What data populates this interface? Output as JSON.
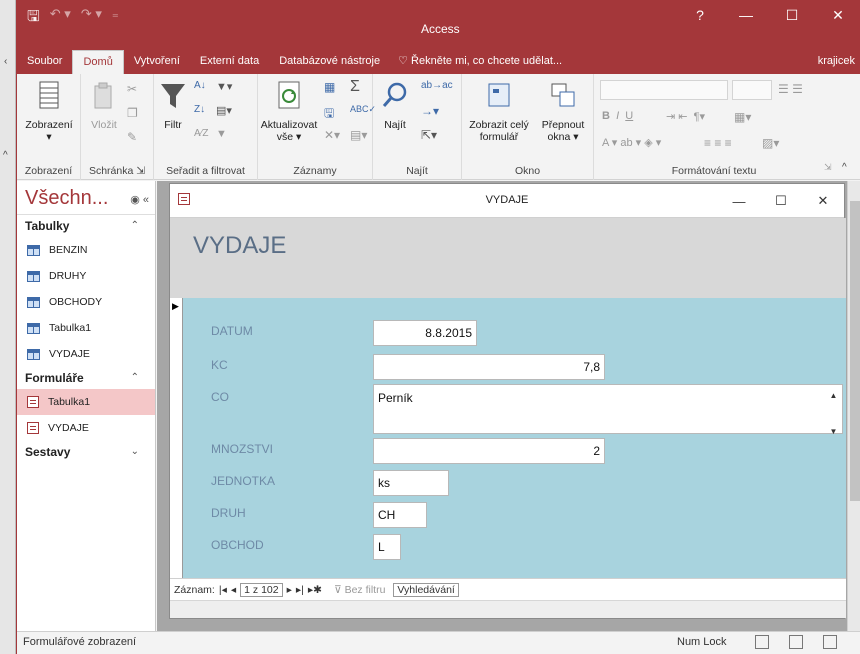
{
  "titlebar": {
    "app_title": "Access",
    "help": "?",
    "minimize": "—",
    "maximize": "☐",
    "close": "✕"
  },
  "tabs": {
    "items": [
      "Soubor",
      "Domů",
      "Vytvoření",
      "Externí data",
      "Databázové nástroje"
    ],
    "active": "Domů",
    "tell_me": "Řekněte mi, co chcete udělat...",
    "user": "krajicek"
  },
  "ribbon": {
    "groups": {
      "zobrazeni": "Zobrazení",
      "schranka": "Schránka",
      "seradit": "Seřadit a filtrovat",
      "zaznamy": "Záznamy",
      "najit": "Najít",
      "okno": "Okno",
      "formatovani": "Formátování textu"
    },
    "buttons": {
      "zobrazeni": "Zobrazení",
      "vlozit": "Vložit",
      "filtr": "Filtr",
      "aktualizovat": "Aktualizovat",
      "aktualizovat2": "vše ▾",
      "najit": "Najít",
      "zobrazit_cely": "Zobrazit celý",
      "formular": "formulář",
      "prepnout": "Přepnout",
      "okna": "okna ▾"
    }
  },
  "nav": {
    "title": "Všechn...",
    "sections": {
      "tabulky": "Tabulky",
      "formulare": "Formuláře",
      "sestavy": "Sestavy"
    },
    "tables": [
      "BENZIN",
      "DRUHY",
      "OBCHODY",
      "Tabulka1",
      "VYDAJE"
    ],
    "forms": [
      "Tabulka1",
      "VYDAJE"
    ]
  },
  "form": {
    "window_title": "VYDAJE",
    "header_title": "VYDAJE",
    "fields": {
      "datum": {
        "label": "DATUM",
        "value": "8.8.2015"
      },
      "kc": {
        "label": "KC",
        "value": "7,8"
      },
      "co": {
        "label": "CO",
        "value": "Perník"
      },
      "mnozstvi": {
        "label": "MNOZSTVI",
        "value": "2"
      },
      "jednotka": {
        "label": "JEDNOTKA",
        "value": "ks"
      },
      "druh": {
        "label": "DRUH",
        "value": "CH"
      },
      "obchod": {
        "label": "OBCHOD",
        "value": "L"
      }
    },
    "record_nav": {
      "label": "Záznam:",
      "current": "1 z 102",
      "filter": "Bez filtru",
      "search": "Vyhledávání"
    }
  },
  "status": {
    "left": "Formulářové zobrazení",
    "numlock": "Num Lock"
  },
  "colors": {
    "accent": "#a4373a",
    "form_body": "#a8d3de",
    "form_header": "#d8d8d8",
    "label": "#6e8aa6",
    "selected_nav": "#f4c7c8"
  }
}
